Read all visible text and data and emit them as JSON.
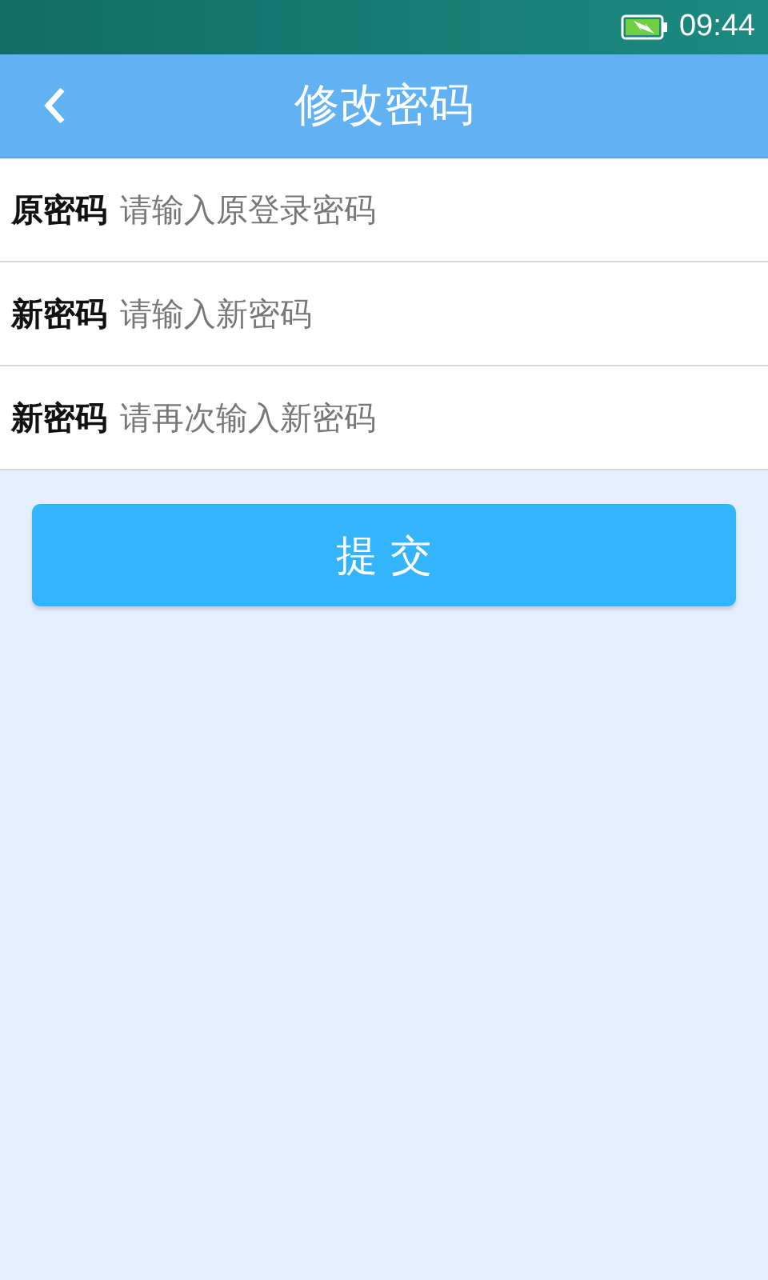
{
  "status_bar": {
    "time": "09:44",
    "charging": true
  },
  "header": {
    "title": "修改密码"
  },
  "fields": [
    {
      "label": "原密码",
      "placeholder": "请输入原登录密码"
    },
    {
      "label": "新密码",
      "placeholder": "请输入新密码"
    },
    {
      "label": "新密码",
      "placeholder": "请再次输入新密码"
    }
  ],
  "submit_button": "提 交"
}
